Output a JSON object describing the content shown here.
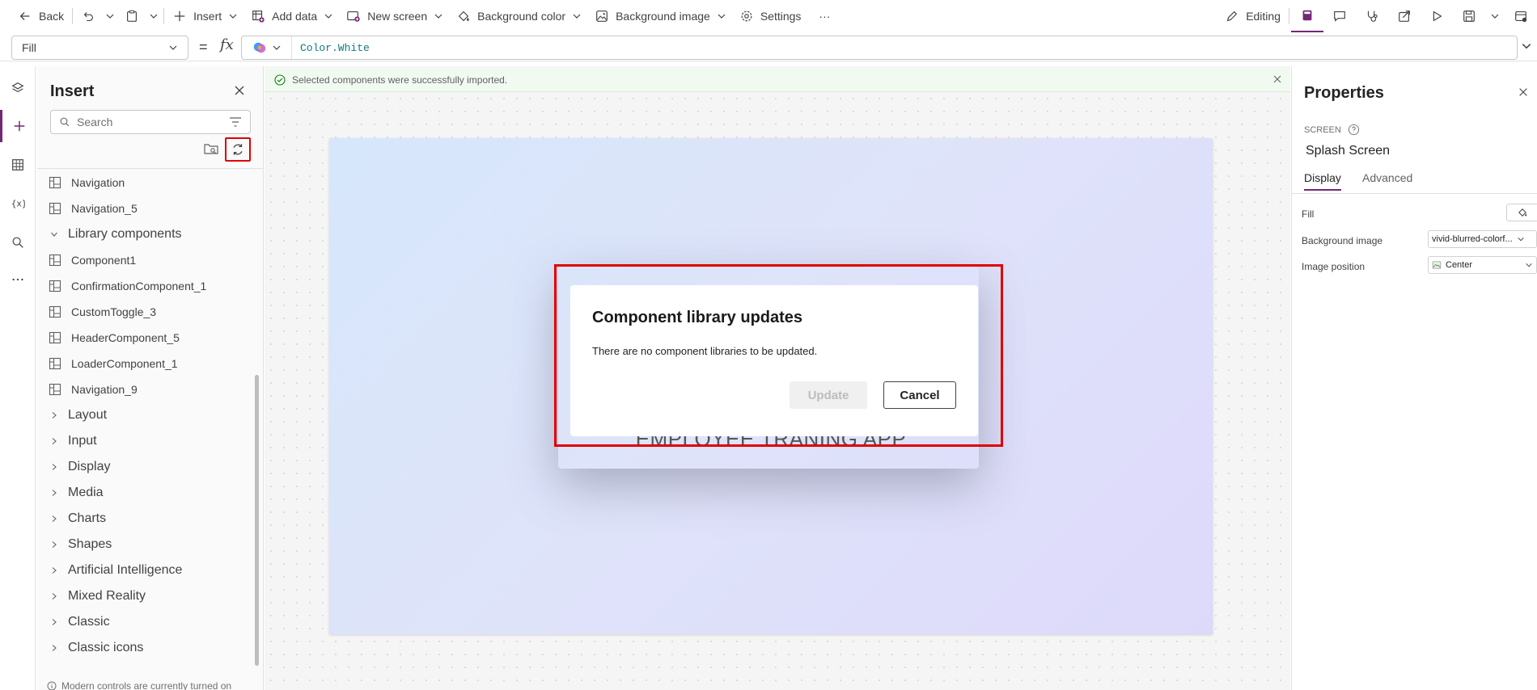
{
  "toolbar": {
    "back": "Back",
    "insert": "Insert",
    "add_data": "Add data",
    "new_screen": "New screen",
    "background_color": "Background color",
    "background_image": "Background image",
    "settings": "Settings",
    "more": "···",
    "editing": "Editing"
  },
  "formula": {
    "property": "Fill",
    "equals": "=",
    "fx": "fx",
    "value": "Color.White"
  },
  "insert_pane": {
    "title": "Insert",
    "search_placeholder": "Search",
    "items_top": [
      "Navigation",
      "Navigation_5"
    ],
    "library_group": "Library components",
    "library_items": [
      "Component1",
      "ConfirmationComponent_1",
      "CustomToggle_3",
      "HeaderComponent_5",
      "LoaderComponent_1",
      "Navigation_9"
    ],
    "groups": [
      "Layout",
      "Input",
      "Display",
      "Media",
      "Charts",
      "Shapes",
      "Artificial Intelligence",
      "Mixed Reality",
      "Classic",
      "Classic icons"
    ],
    "footer_note": "Modern controls are currently turned on"
  },
  "notification": {
    "message": "Selected components were successfully imported."
  },
  "canvas": {
    "app_title": "EMPLOYEE TRANING APP"
  },
  "dialog": {
    "title": "Component library updates",
    "message": "There are no component libraries to be updated.",
    "update_label": "Update",
    "cancel_label": "Cancel"
  },
  "properties": {
    "title": "Properties",
    "section_tag": "SCREEN",
    "screen_name": "Splash Screen",
    "tab_display": "Display",
    "tab_advanced": "Advanced",
    "fill_label": "Fill",
    "bg_image_label": "Background image",
    "bg_image_value": "vivid-blurred-colorf...",
    "image_position_label": "Image position",
    "image_position_value": "Center"
  },
  "colors": {
    "accent": "#742774",
    "highlight": "#e00000",
    "success_bg": "#f1faf1"
  }
}
